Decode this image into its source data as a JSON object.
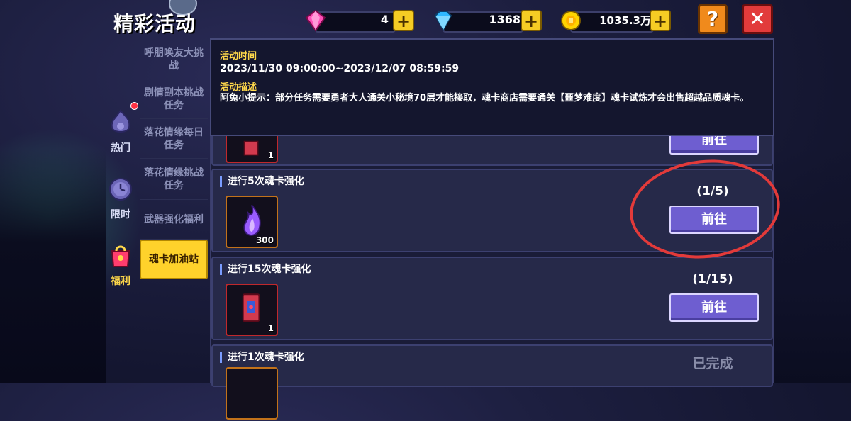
{
  "title": "精彩活动",
  "resources": [
    {
      "icon": "pink-gem-icon",
      "value": "4"
    },
    {
      "icon": "blue-diamond-icon",
      "value": "1368"
    },
    {
      "icon": "gold-coin-icon",
      "value": "1035.3万"
    }
  ],
  "plus_label": "+",
  "help_label": "?",
  "close_label": "✕",
  "categories": [
    {
      "label": "热门",
      "icon": "flame-bag-icon"
    },
    {
      "label": "限时",
      "icon": "clock-icon"
    },
    {
      "label": "福利",
      "icon": "gift-bag-icon"
    }
  ],
  "sub_tabs": [
    "呼朋唤友大挑战",
    "剧情副本挑战任务",
    "落花情缘每日任务",
    "落花情缘挑战任务",
    "武器强化福利",
    "魂卡加油站"
  ],
  "info": {
    "time_heading": "活动时间",
    "time_value": "2023/11/30 09:00:00~2023/12/07 08:59:59",
    "desc_heading": "活动描述",
    "desc_value": "阿兔小提示：部分任务需要勇者大人通关小秘境70层才能接取，魂卡商店需要通关【噩梦难度】魂卡试炼才会出售超越品质魂卡。"
  },
  "partial_card": {
    "qty": "1",
    "button": "前往"
  },
  "tasks": [
    {
      "name": "进行5次魂卡强化",
      "progress": "(1/5)",
      "reward_icon": "purple-soul-flame-icon",
      "qty": "300",
      "button": "前往"
    },
    {
      "name": "进行15次魂卡强化",
      "progress": "(1/15)",
      "reward_icon": "red-soul-card-icon",
      "qty": "1",
      "button": "前往"
    },
    {
      "name": "进行1次魂卡强化",
      "status": "已完成",
      "reward_icon": "soul-item-icon"
    }
  ],
  "colors": {
    "accent_yellow": "#ffd22b",
    "button_purple": "#6e5ed0",
    "annotation_red": "#e23a3a"
  }
}
